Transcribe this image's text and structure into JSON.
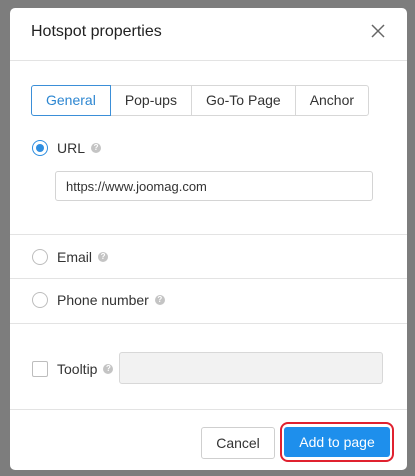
{
  "dialog": {
    "title": "Hotspot properties",
    "close_icon": "close-icon"
  },
  "tabs": [
    {
      "label": "General",
      "active": true
    },
    {
      "label": "Pop-ups",
      "active": false
    },
    {
      "label": "Go-To Page",
      "active": false
    },
    {
      "label": "Anchor",
      "active": false
    }
  ],
  "options": {
    "url": {
      "label": "URL",
      "checked": true,
      "value": "https://www.joomag.com"
    },
    "email": {
      "label": "Email",
      "checked": false
    },
    "phone": {
      "label": "Phone number",
      "checked": false
    },
    "tooltip": {
      "label": "Tooltip",
      "checked": false,
      "value": ""
    }
  },
  "help_glyph": "?",
  "footer": {
    "cancel_label": "Cancel",
    "add_label": "Add to page"
  },
  "colors": {
    "accent": "#1e8fec",
    "highlight": "#e0212f"
  }
}
